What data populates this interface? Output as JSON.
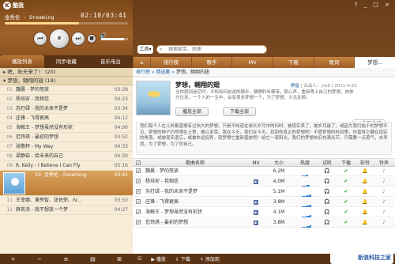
{
  "app": {
    "name": "酷我",
    "logo": "K"
  },
  "player": {
    "now_playing": "金秀伦 - Dreaming",
    "time": "02:10/03:41",
    "progress": 0.6,
    "volume": 0.85,
    "controls": {
      "prev": "⏮",
      "pause": "⏸",
      "next": "⏭",
      "stop": "■"
    }
  },
  "left_tabs": [
    "播放列表",
    "同步收藏",
    "音乐电台"
  ],
  "left_list": {
    "group1": "▸ 嗯，秋天来了！ (20)",
    "group2": "▾ 梦想，翱翔的翅 (18)",
    "rows": [
      {
        "n": "01",
        "title": "魏晨 - 梦的怒放",
        "dur": "03:28"
      },
      {
        "n": "02",
        "title": "杨培安 - 我相信",
        "dur": "04:23"
      },
      {
        "n": "03",
        "title": "苏打绿 - 我的未来不是梦",
        "dur": "03:34"
      },
      {
        "n": "04",
        "title": "庄锋 - 飞得更高",
        "dur": "04:12"
      },
      {
        "n": "05",
        "title": "海鲸王 - 梦想虽然没有形状",
        "dur": "04:00"
      },
      {
        "n": "06",
        "title": "范玮琪 - 最初的梦想",
        "dur": "03:52"
      },
      {
        "n": "07",
        "title": "张敬轩 - My Way",
        "dur": "04:33"
      },
      {
        "n": "08",
        "title": "梁静茹 - 给未来的自己",
        "dur": "04:30"
      },
      {
        "n": "09",
        "title": "R. Kelly - I Believe I Can Fly",
        "dur": "05:16"
      }
    ],
    "playing": {
      "n": "10",
      "title": "金秀伦 - Dreaming",
      "dur": "03:41"
    },
    "rows_after": [
      {
        "n": "11",
        "title": "王菲娜、黄秀智、张佐荣、IV...",
        "dur": "03:50"
      },
      {
        "n": "12",
        "title": "薛英活 - 我不想放一个梦",
        "dur": "04:27"
      }
    ]
  },
  "left_footer": [
    "+",
    "−",
    "≡",
    "▤",
    "⊞"
  ],
  "window_buttons": "? _ □ ×",
  "search": {
    "tools": "工具▾",
    "placeholder": "搜索歌手、歌曲"
  },
  "right_tabs": [
    "⌂",
    "排行榜",
    "歌手",
    "MV",
    "下载",
    "歌词",
    "梦想..."
  ],
  "breadcrumb": {
    "a": "排行榜",
    "b": "精选集",
    "cur": "梦想，翱翔的翅"
  },
  "album": {
    "title": "梦想，翱翔的翅",
    "meta_label": "群星",
    "meta_rest": "| 出品人：yix8 | 2011-9-23",
    "desc": "当你感到迷茫时，不知如何前进的脚步，静静聆听哪带，那心声，重新等上自己的梦想，肉体方位发。一个人的一生中，会有很多梦想一个，为了梦想，义无反顾。",
    "play_all": "播放全部",
    "download_all": "下载全部",
    "collapse": "∧ 收起介绍",
    "long_desc": "我们每个人在儿时都曾拥有过伟大的梦想。只是不知道在成长岁月中的何时，被现实丢了，被岁月敲了，或因为我们始于的梦想不见，梦想的种子仍然埋在土里，难以发芽。我在今天，我们在今天，找回你真正的梦想吧！不管梦想的时间里，你曾将它藏在现实的角落，或被现实遗忘，或被命运捉弄，就梦想它重新盛放吧！给它一束阳光，我们的梦想依旧充满光芒。只需要一点勇气，去寻找，为了梦想，为了你自己。"
  },
  "table": {
    "headers": [
      "歌曲名称",
      "MV",
      "大小",
      "热度",
      "试听",
      "下载",
      "彩铃",
      "铃声"
    ],
    "rows": [
      {
        "title": "魏晨 - 梦的怒放",
        "mv": false,
        "size": "6.2M",
        "heat": 7
      },
      {
        "title": "杨培安 - 我相信",
        "mv": true,
        "size": "4.0M",
        "heat": 8
      },
      {
        "title": "苏打绿 - 我的未来不是梦",
        "mv": false,
        "size": "5.1M",
        "heat": 9
      },
      {
        "title": "庄锋 - 飞得更高",
        "mv": true,
        "size": "3.8M",
        "heat": 9
      },
      {
        "title": "海鲸王 - 梦想虽然没有形状",
        "mv": true,
        "size": "4.1M",
        "heat": 9
      },
      {
        "title": "范玮琪 - 最初的梦想",
        "mv": true,
        "size": "3.8M",
        "heat": 9
      }
    ]
  },
  "right_footer": [
    "☑",
    "▶ 播放",
    "⇩ 下载",
    "+ 添加到"
  ],
  "watermark": "新浪科技之家"
}
